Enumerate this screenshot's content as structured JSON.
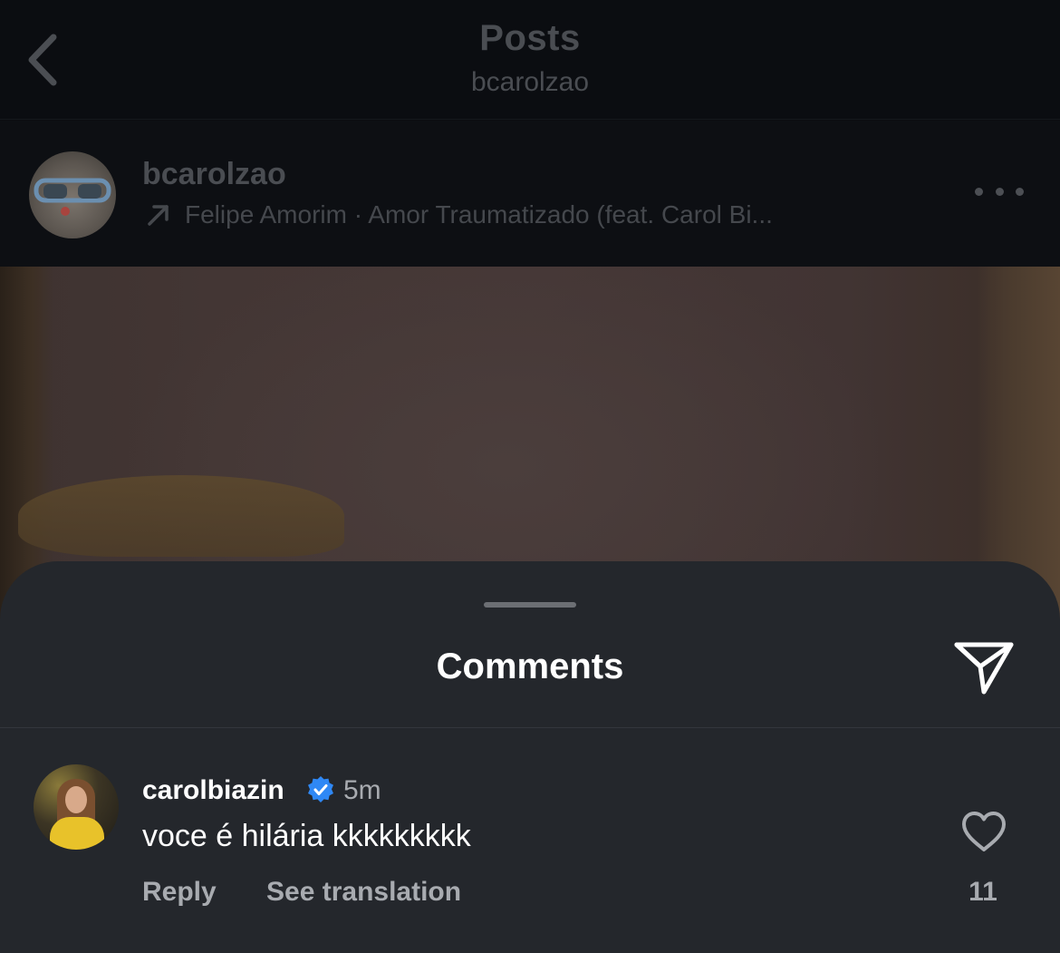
{
  "nav": {
    "title": "Posts",
    "subtitle": "bcarolzao"
  },
  "post": {
    "username": "bcarolzao",
    "music": "Felipe Amorim · Amor Traumatizado (feat. Carol Bi..."
  },
  "sheet": {
    "title": "Comments"
  },
  "comment": {
    "username": "carolbiazin",
    "time": "5m",
    "text": "voce é hilária kkkkkkkkk",
    "reply_label": "Reply",
    "translation_label": "See translation",
    "like_count": "11",
    "verified": true
  },
  "colors": {
    "sheet_bg": "#24272c",
    "verified_blue": "#2f88f5",
    "muted_text": "#a8abb0"
  },
  "icons": [
    "back-chevron-icon",
    "trending-arrow-icon",
    "more-options-icon",
    "send-icon",
    "verified-badge-icon",
    "heart-icon"
  ]
}
